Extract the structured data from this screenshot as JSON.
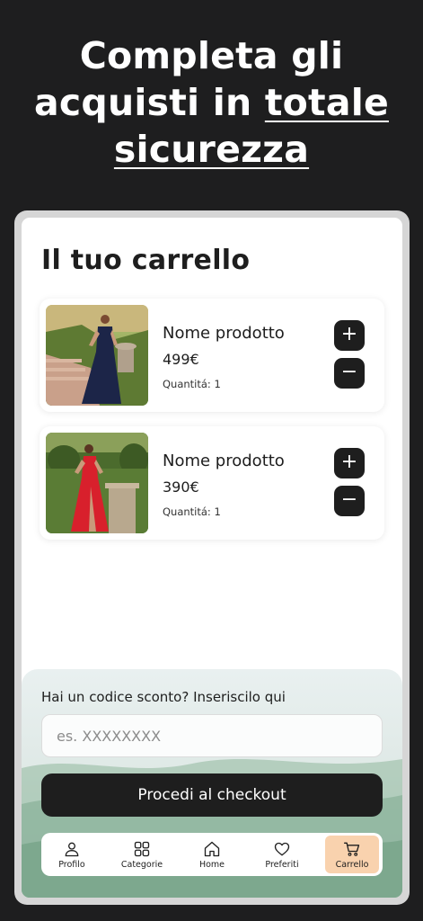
{
  "headline": {
    "line1": "Completa gli",
    "line2_plain": "acquisti in ",
    "line2_underlined": "totale",
    "line3_underlined": "sicurezza"
  },
  "cart": {
    "title": "Il tuo carrello",
    "items": [
      {
        "name": "Nome prodotto",
        "price": "499€",
        "quantity": "Quantitá: 1",
        "plus": "+",
        "minus": "−"
      },
      {
        "name": "Nome prodotto",
        "price": "390€",
        "quantity": "Quantitá: 1",
        "plus": "+",
        "minus": "−"
      }
    ]
  },
  "promo": {
    "label": "Hai un codice sconto? Inseriscilo qui",
    "placeholder": "es. XXXXXXXX"
  },
  "checkout": {
    "label": "Procedi al checkout"
  },
  "nav": {
    "items": [
      {
        "label": "Profilo",
        "icon": "user-icon"
      },
      {
        "label": "Categorie",
        "icon": "grid-icon"
      },
      {
        "label": "Home",
        "icon": "home-icon"
      },
      {
        "label": "Preferiti",
        "icon": "heart-icon"
      },
      {
        "label": "Carrello",
        "icon": "cart-icon",
        "active": true
      }
    ]
  },
  "colors": {
    "background": "#1e1e1f",
    "button_dark": "#1e1e1e",
    "nav_active": "#f9d2ae"
  }
}
